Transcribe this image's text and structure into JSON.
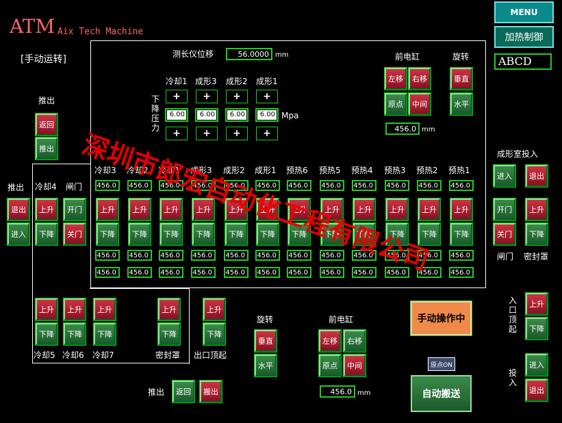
{
  "brand": {
    "title": "ATM",
    "subtitle": "Aix Tech Machine"
  },
  "mode": "[手动运转]",
  "menu": {
    "menu": "MENU",
    "heat": "加热制御",
    "input": "ABCD"
  },
  "measure": {
    "label": "测长仪位移",
    "value": "56.0000",
    "unit": "mm"
  },
  "press": {
    "cols": [
      "冷却1",
      "成形3",
      "成形2",
      "成形1"
    ],
    "side": "下降压力",
    "values": [
      "6.00",
      "6.00",
      "6.00",
      "6.00"
    ],
    "unit": "Mpa",
    "plus": "+"
  },
  "front": {
    "title": "前电缸",
    "left": "左移",
    "right": "右移",
    "origin": "原点",
    "middle": "中间",
    "value": "456.0",
    "unit": "mm"
  },
  "rotate": {
    "title": "旋转",
    "vertical": "垂直",
    "horizontal": "水平"
  },
  "push_left": {
    "title": "推出",
    "back": "返回",
    "out": "推出"
  },
  "stations": [
    "冷却3",
    "冷却2",
    "冷却1",
    "成形3",
    "成形2",
    "成形1",
    "预热6",
    "预热5",
    "预热4",
    "预热3",
    "预热2",
    "预热1"
  ],
  "sval": "456.0",
  "up": "上升",
  "down": "下降",
  "left_block": {
    "push": "推出",
    "c4": "冷却4",
    "gate": "闸门",
    "exit": "退出",
    "enter": "进入",
    "open": "开门",
    "close": "关门"
  },
  "bottom": {
    "c5": "冷却5",
    "c6": "冷却6",
    "c7": "冷却7",
    "seal": "密封罩",
    "outlet": "出口顶起"
  },
  "rot2": {
    "title": "旋转",
    "vertical": "垂直",
    "horizontal": "水平"
  },
  "front2": {
    "title": "前电缸",
    "left": "左移",
    "right": "右移",
    "origin": "原点",
    "middle": "中间",
    "value": "456.0",
    "unit": "mm"
  },
  "push_bottom": {
    "label": "推出",
    "back": "返回",
    "out": "搬出"
  },
  "right": {
    "insert_title": "成形室投入",
    "enter": "进入",
    "exit": "退出",
    "open": "开门",
    "up": "上升",
    "close": "关门",
    "down": "下降",
    "gate": "闸门",
    "seal": "密封罩",
    "inlet": "入口顶起",
    "insert": "投入",
    "enter2": "进入",
    "exit2": "退出"
  },
  "manual": "手动操作中",
  "origin_on": "原点ON",
  "auto": "自动搬送",
  "watermark": "深圳市郎宏自动化工程有限公司",
  "colors": {
    "green_btn": "#2a7a3a",
    "red_btn": "#aa2030",
    "orange": "#f08a4a",
    "frame": "#22cc22"
  }
}
